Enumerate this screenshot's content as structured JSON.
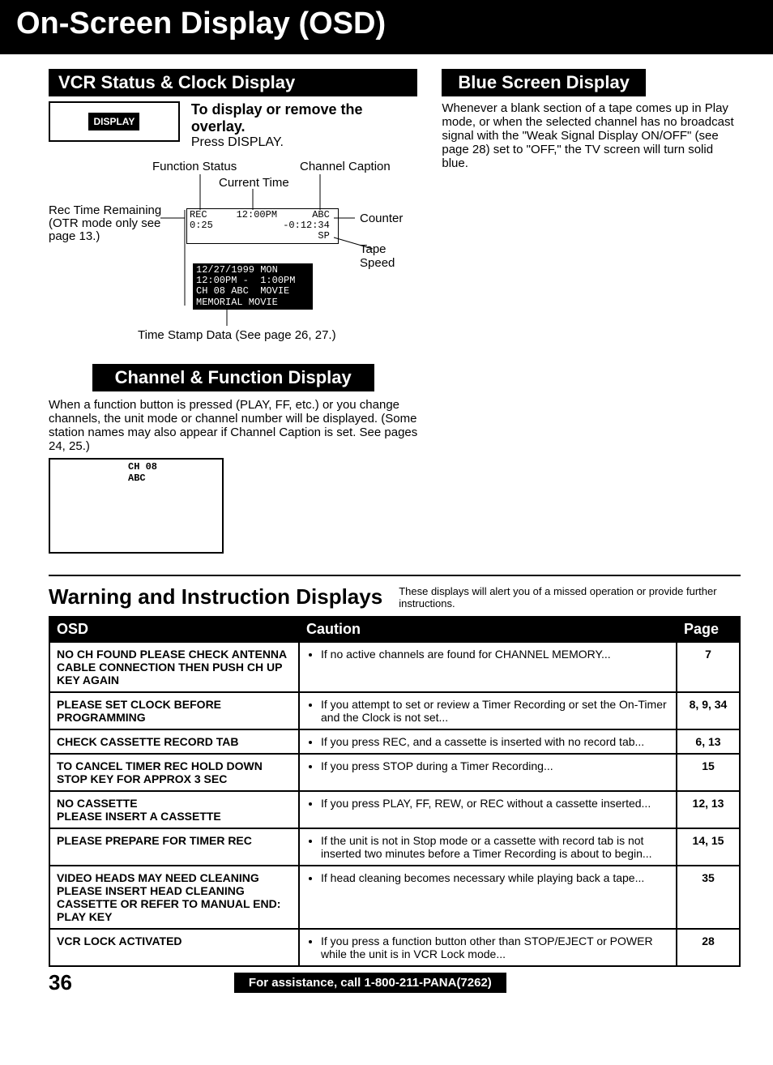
{
  "title": "On-Screen Display (OSD)",
  "sections": {
    "vcr": {
      "header": "VCR Status & Clock Display",
      "button_label": "DISPLAY",
      "overlay_bold": "To display or remove the overlay.",
      "overlay_plain": "Press DISPLAY.",
      "labels": {
        "function_status": "Function Status",
        "current_time": "Current Time",
        "channel_caption": "Channel Caption",
        "rec_remain_1": "Rec Time Remaining",
        "rec_remain_2": "(OTR mode only see",
        "rec_remain_3": "page 13.)",
        "counter": "Counter",
        "tape_speed": "Tape Speed",
        "time_stamp": "Time Stamp Data (See page 26, 27.)"
      },
      "osd": {
        "line1": "REC     12:00PM      ABC",
        "line2": "0:25            -0:12:34",
        "line3": "                      SP",
        "black1": "12/27/1999 MON",
        "black2": "12:00PM -  1:00PM",
        "black3": "CH 08 ABC  MOVIE",
        "black4": "MEMORIAL MOVIE"
      }
    },
    "channel": {
      "header": "Channel & Function Display",
      "para": "When a function button is pressed (PLAY, FF, etc.) or you change channels, the unit mode or channel number will be displayed. (Some station names may also appear if Channel Caption is set. See pages 24, 25.)",
      "osd_line1": "CH 08",
      "osd_line2": "ABC"
    },
    "blue": {
      "header": "Blue Screen Display",
      "para": "Whenever a blank section of a tape comes up in Play mode, or when the selected channel has no broadcast signal with the \"Weak Signal Display ON/OFF\" (see page 28) set to \"OFF,\" the TV screen will turn solid blue."
    }
  },
  "warning": {
    "title": "Warning and Instruction Displays",
    "sub": "These displays will alert you of a missed operation or provide further instructions.",
    "headers": {
      "osd": "OSD",
      "caution": "Caution",
      "page": "Page"
    },
    "rows": [
      {
        "osd": "NO CH FOUND PLEASE CHECK ANTENNA CABLE CONNECTION THEN PUSH CH UP KEY AGAIN",
        "caution": "If no active channels are found for CHANNEL MEMORY...",
        "page": "7"
      },
      {
        "osd": "PLEASE SET CLOCK BEFORE PROGRAMMING",
        "caution": "If you attempt to set or review a Timer Recording or set the On-Timer and the Clock is not set...",
        "page": "8, 9, 34"
      },
      {
        "osd": "CHECK CASSETTE RECORD TAB",
        "caution": "If you press REC, and a cassette is inserted with no record tab...",
        "page": "6, 13"
      },
      {
        "osd": "TO CANCEL TIMER REC HOLD DOWN STOP KEY FOR APPROX 3 SEC",
        "caution": "If you press STOP during a Timer Recording...",
        "page": "15"
      },
      {
        "osd": "NO CASSETTE\nPLEASE INSERT A CASSETTE",
        "caution": "If you press PLAY, FF, REW, or REC without a cassette inserted...",
        "page": "12, 13"
      },
      {
        "osd": "PLEASE PREPARE FOR TIMER REC",
        "caution": "If the unit is not in Stop mode or a cassette with record tab is not inserted two minutes before a Timer Recording is about to begin...",
        "page": "14, 15"
      },
      {
        "osd": "VIDEO HEADS MAY NEED CLEANING PLEASE INSERT HEAD CLEANING CASSETTE OR REFER TO MANUAL END: PLAY KEY",
        "caution": "If head cleaning becomes necessary while playing back a tape...",
        "page": "35"
      },
      {
        "osd": "VCR LOCK ACTIVATED",
        "caution": "If you press a function button other than STOP/EJECT or POWER while the unit is in VCR Lock mode...",
        "page": "28"
      }
    ]
  },
  "footer": {
    "page": "36",
    "assistance": "For assistance, call 1-800-211-PANA(7262)"
  }
}
